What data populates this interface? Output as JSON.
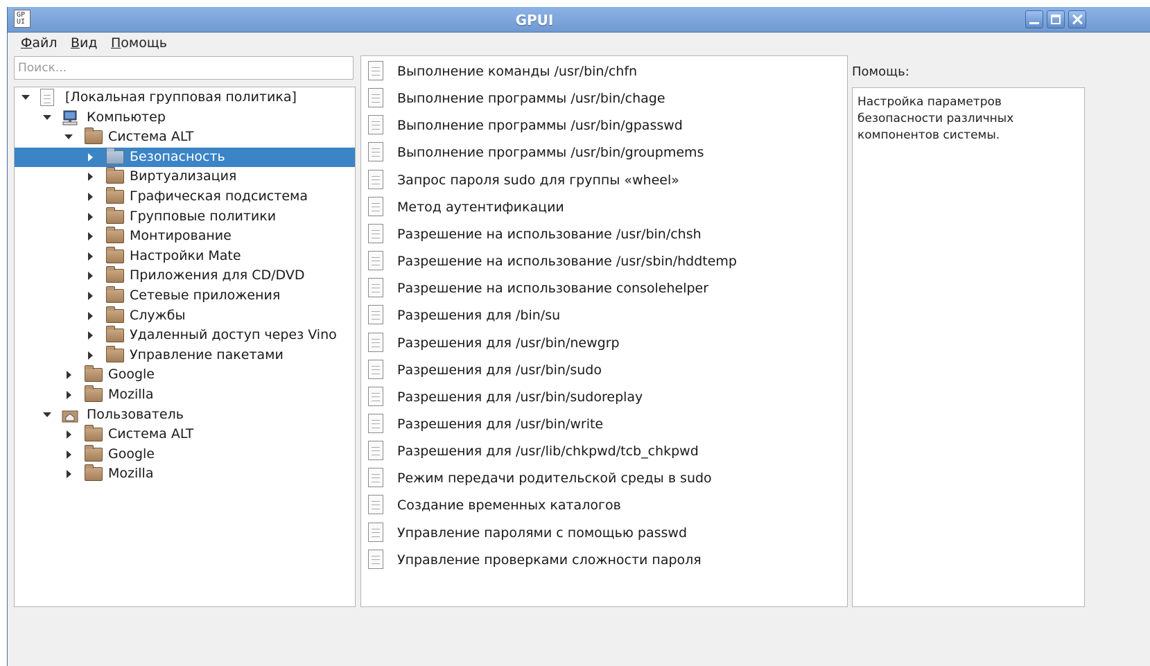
{
  "window": {
    "title": "GPUI",
    "app_icon_text": "GP\nUI"
  },
  "menu": {
    "file": {
      "accel": "Ф",
      "rest": "айл"
    },
    "view": {
      "accel": "В",
      "rest": "ид"
    },
    "help": {
      "accel": "П",
      "rest": "омощь"
    }
  },
  "search": {
    "placeholder": "Поиск...",
    "value": ""
  },
  "tree": [
    {
      "label": "[Локальная групповая политика]",
      "depth": 0,
      "expanded": true,
      "icon": "document-icon",
      "selected": false
    },
    {
      "label": "Компьютер",
      "depth": 1,
      "expanded": true,
      "icon": "computer-icon",
      "selected": false
    },
    {
      "label": "Система ALT",
      "depth": 2,
      "expanded": true,
      "icon": "folder-icon",
      "selected": false
    },
    {
      "label": "Безопасность",
      "depth": 3,
      "expanded": false,
      "icon": "folder-icon",
      "selected": true
    },
    {
      "label": "Виртуализация",
      "depth": 3,
      "expanded": false,
      "icon": "folder-icon",
      "selected": false
    },
    {
      "label": "Графическая подсистема",
      "depth": 3,
      "expanded": false,
      "icon": "folder-icon",
      "selected": false
    },
    {
      "label": "Групповые политики",
      "depth": 3,
      "expanded": false,
      "icon": "folder-icon",
      "selected": false
    },
    {
      "label": "Монтирование",
      "depth": 3,
      "expanded": false,
      "icon": "folder-icon",
      "selected": false
    },
    {
      "label": "Настройки Mate",
      "depth": 3,
      "expanded": false,
      "icon": "folder-icon",
      "selected": false
    },
    {
      "label": "Приложения для CD/DVD",
      "depth": 3,
      "expanded": false,
      "icon": "folder-icon",
      "selected": false
    },
    {
      "label": "Сетевые приложения",
      "depth": 3,
      "expanded": false,
      "icon": "folder-icon",
      "selected": false
    },
    {
      "label": "Службы",
      "depth": 3,
      "expanded": false,
      "icon": "folder-icon",
      "selected": false
    },
    {
      "label": "Удаленный доступ через Vino",
      "depth": 3,
      "expanded": false,
      "icon": "folder-icon",
      "selected": false
    },
    {
      "label": "Управление пакетами",
      "depth": 3,
      "expanded": false,
      "icon": "folder-icon",
      "selected": false
    },
    {
      "label": "Google",
      "depth": 2,
      "expanded": false,
      "icon": "folder-icon",
      "selected": false
    },
    {
      "label": "Mozilla",
      "depth": 2,
      "expanded": false,
      "icon": "folder-icon",
      "selected": false
    },
    {
      "label": "Пользователь",
      "depth": 1,
      "expanded": true,
      "icon": "home-icon",
      "selected": false
    },
    {
      "label": "Система ALT",
      "depth": 2,
      "expanded": false,
      "icon": "folder-icon",
      "selected": false
    },
    {
      "label": "Google",
      "depth": 2,
      "expanded": false,
      "icon": "folder-icon",
      "selected": false
    },
    {
      "label": "Mozilla",
      "depth": 2,
      "expanded": false,
      "icon": "folder-icon",
      "selected": false
    }
  ],
  "policies": [
    "Выполнение команды /usr/bin/chfn",
    "Выполнение программы /usr/bin/chage",
    "Выполнение программы /usr/bin/gpasswd",
    "Выполнение программы /usr/bin/groupmems",
    "Запрос пароля sudo для группы «wheel»",
    "Метод аутентификации",
    "Разрешение на использование /usr/bin/chsh",
    "Разрешение на использование /usr/sbin/hddtemp",
    "Разрешение на использование consolehelper",
    "Разрешения для /bin/su",
    "Разрешения для /usr/bin/newgrp",
    "Разрешения для /usr/bin/sudo",
    "Разрешения для /usr/bin/sudoreplay",
    "Разрешения для /usr/bin/write",
    "Разрешения для /usr/lib/chkpwd/tcb_chkpwd",
    "Режим передачи родительской среды в sudo",
    "Создание временных каталогов",
    "Управление паролями с помощью passwd",
    "Управление проверками сложности пароля"
  ],
  "help": {
    "label": "Помощь:",
    "text": "Настройка параметров безопасности различных компонентов системы."
  },
  "colors": {
    "titlebar": "#7aa3d9",
    "selection": "#3b84c6"
  }
}
